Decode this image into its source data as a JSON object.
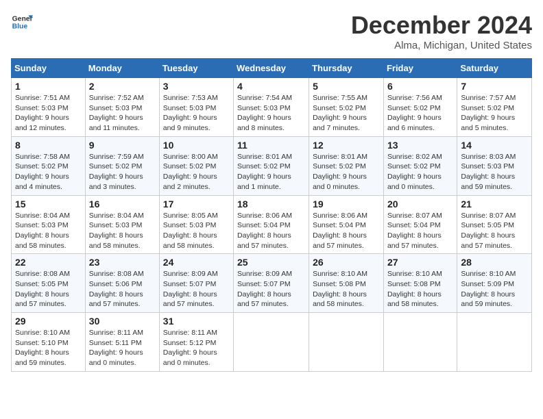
{
  "logo": {
    "line1": "General",
    "line2": "Blue"
  },
  "title": "December 2024",
  "location": "Alma, Michigan, United States",
  "days_of_week": [
    "Sunday",
    "Monday",
    "Tuesday",
    "Wednesday",
    "Thursday",
    "Friday",
    "Saturday"
  ],
  "weeks": [
    [
      {
        "day": "1",
        "sunrise": "7:51 AM",
        "sunset": "5:03 PM",
        "daylight": "9 hours and 12 minutes."
      },
      {
        "day": "2",
        "sunrise": "7:52 AM",
        "sunset": "5:03 PM",
        "daylight": "9 hours and 11 minutes."
      },
      {
        "day": "3",
        "sunrise": "7:53 AM",
        "sunset": "5:03 PM",
        "daylight": "9 hours and 9 minutes."
      },
      {
        "day": "4",
        "sunrise": "7:54 AM",
        "sunset": "5:03 PM",
        "daylight": "9 hours and 8 minutes."
      },
      {
        "day": "5",
        "sunrise": "7:55 AM",
        "sunset": "5:02 PM",
        "daylight": "9 hours and 7 minutes."
      },
      {
        "day": "6",
        "sunrise": "7:56 AM",
        "sunset": "5:02 PM",
        "daylight": "9 hours and 6 minutes."
      },
      {
        "day": "7",
        "sunrise": "7:57 AM",
        "sunset": "5:02 PM",
        "daylight": "9 hours and 5 minutes."
      }
    ],
    [
      {
        "day": "8",
        "sunrise": "7:58 AM",
        "sunset": "5:02 PM",
        "daylight": "9 hours and 4 minutes."
      },
      {
        "day": "9",
        "sunrise": "7:59 AM",
        "sunset": "5:02 PM",
        "daylight": "9 hours and 3 minutes."
      },
      {
        "day": "10",
        "sunrise": "8:00 AM",
        "sunset": "5:02 PM",
        "daylight": "9 hours and 2 minutes."
      },
      {
        "day": "11",
        "sunrise": "8:01 AM",
        "sunset": "5:02 PM",
        "daylight": "9 hours and 1 minute."
      },
      {
        "day": "12",
        "sunrise": "8:01 AM",
        "sunset": "5:02 PM",
        "daylight": "9 hours and 0 minutes."
      },
      {
        "day": "13",
        "sunrise": "8:02 AM",
        "sunset": "5:02 PM",
        "daylight": "9 hours and 0 minutes."
      },
      {
        "day": "14",
        "sunrise": "8:03 AM",
        "sunset": "5:03 PM",
        "daylight": "8 hours and 59 minutes."
      }
    ],
    [
      {
        "day": "15",
        "sunrise": "8:04 AM",
        "sunset": "5:03 PM",
        "daylight": "8 hours and 58 minutes."
      },
      {
        "day": "16",
        "sunrise": "8:04 AM",
        "sunset": "5:03 PM",
        "daylight": "8 hours and 58 minutes."
      },
      {
        "day": "17",
        "sunrise": "8:05 AM",
        "sunset": "5:03 PM",
        "daylight": "8 hours and 58 minutes."
      },
      {
        "day": "18",
        "sunrise": "8:06 AM",
        "sunset": "5:04 PM",
        "daylight": "8 hours and 57 minutes."
      },
      {
        "day": "19",
        "sunrise": "8:06 AM",
        "sunset": "5:04 PM",
        "daylight": "8 hours and 57 minutes."
      },
      {
        "day": "20",
        "sunrise": "8:07 AM",
        "sunset": "5:04 PM",
        "daylight": "8 hours and 57 minutes."
      },
      {
        "day": "21",
        "sunrise": "8:07 AM",
        "sunset": "5:05 PM",
        "daylight": "8 hours and 57 minutes."
      }
    ],
    [
      {
        "day": "22",
        "sunrise": "8:08 AM",
        "sunset": "5:05 PM",
        "daylight": "8 hours and 57 minutes."
      },
      {
        "day": "23",
        "sunrise": "8:08 AM",
        "sunset": "5:06 PM",
        "daylight": "8 hours and 57 minutes."
      },
      {
        "day": "24",
        "sunrise": "8:09 AM",
        "sunset": "5:07 PM",
        "daylight": "8 hours and 57 minutes."
      },
      {
        "day": "25",
        "sunrise": "8:09 AM",
        "sunset": "5:07 PM",
        "daylight": "8 hours and 57 minutes."
      },
      {
        "day": "26",
        "sunrise": "8:10 AM",
        "sunset": "5:08 PM",
        "daylight": "8 hours and 58 minutes."
      },
      {
        "day": "27",
        "sunrise": "8:10 AM",
        "sunset": "5:08 PM",
        "daylight": "8 hours and 58 minutes."
      },
      {
        "day": "28",
        "sunrise": "8:10 AM",
        "sunset": "5:09 PM",
        "daylight": "8 hours and 59 minutes."
      }
    ],
    [
      {
        "day": "29",
        "sunrise": "8:10 AM",
        "sunset": "5:10 PM",
        "daylight": "8 hours and 59 minutes."
      },
      {
        "day": "30",
        "sunrise": "8:11 AM",
        "sunset": "5:11 PM",
        "daylight": "9 hours and 0 minutes."
      },
      {
        "day": "31",
        "sunrise": "8:11 AM",
        "sunset": "5:12 PM",
        "daylight": "9 hours and 0 minutes."
      },
      null,
      null,
      null,
      null
    ]
  ],
  "labels": {
    "sunrise": "Sunrise:",
    "sunset": "Sunset:",
    "daylight": "Daylight:"
  }
}
